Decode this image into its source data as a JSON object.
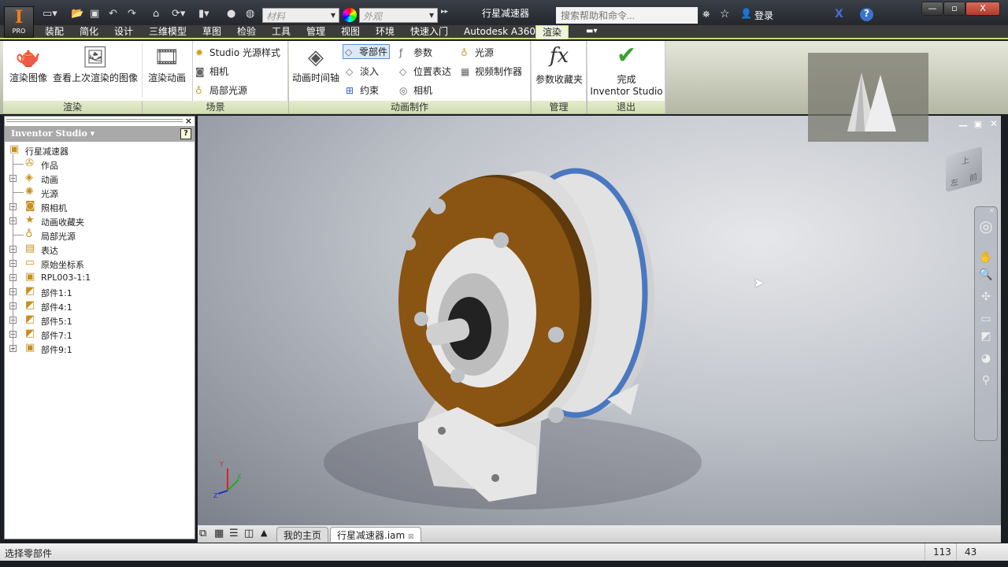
{
  "app": {
    "logo_letter": "I",
    "edition": "PRO",
    "document_title": "行星减速器"
  },
  "quick_access": {
    "material": "材料",
    "appearance": "外观",
    "icons": [
      "new-icon",
      "open-icon",
      "save-icon",
      "undo-icon",
      "redo-icon",
      "home-icon",
      "update-icon",
      "select-icon",
      "color-wheel-icon"
    ]
  },
  "search": {
    "placeholder": "搜索帮助和命令..."
  },
  "account": {
    "signin": "登录"
  },
  "tabs": [
    "装配",
    "简化",
    "设计",
    "三维模型",
    "草图",
    "检验",
    "工具",
    "管理",
    "视图",
    "环境",
    "快速入门",
    "Autodesk A360",
    "渲染"
  ],
  "active_tab": "渲染",
  "ribbon": {
    "render": {
      "label": "渲染",
      "render_image": "渲染图像",
      "view_last": "查看上次渲染的图像",
      "render_animation": "渲染动画"
    },
    "scene": {
      "label": "场景",
      "studio_lighting": "Studio 光源样式",
      "camera": "相机",
      "local_lights": "局部光源"
    },
    "animate": {
      "label": "动画制作",
      "timeline": "动画时间轴",
      "component": "零部件",
      "fade": "淡入",
      "constraints": "约束",
      "parameters": "参数",
      "positional_reps": "位置表达",
      "camera": "相机",
      "light": "光源",
      "video_producer": "视频制作器"
    },
    "manage": {
      "label": "管理",
      "param_favorites": "参数收藏夹"
    },
    "exit": {
      "label": "退出",
      "finish_line1": "完成",
      "finish_line2": "Inventor Studio"
    }
  },
  "browser": {
    "title": "Inventor Studio",
    "nodes": [
      {
        "label": "行星减速器",
        "expander": false,
        "level": 0,
        "icon": "assembly-icon"
      },
      {
        "label": "作品",
        "expander": false,
        "level": 1,
        "icon": "production-icon"
      },
      {
        "label": "动画",
        "expander": true,
        "level": 1,
        "icon": "animation-icon"
      },
      {
        "label": "光源",
        "expander": false,
        "level": 1,
        "icon": "light-icon"
      },
      {
        "label": "照相机",
        "expander": true,
        "level": 1,
        "icon": "camera-icon"
      },
      {
        "label": "动画收藏夹",
        "expander": true,
        "level": 1,
        "icon": "star-icon"
      },
      {
        "label": "局部光源",
        "expander": false,
        "level": 1,
        "icon": "bulb-icon"
      },
      {
        "label": "表达",
        "expander": true,
        "level": 1,
        "icon": "representation-icon"
      },
      {
        "label": "原始坐标系",
        "expander": true,
        "level": 1,
        "icon": "folder-icon"
      },
      {
        "label": "RPL003-1:1",
        "expander": true,
        "level": 1,
        "icon": "assembly-icon"
      },
      {
        "label": "部件1:1",
        "expander": true,
        "level": 1,
        "icon": "part-icon"
      },
      {
        "label": "部件4:1",
        "expander": true,
        "level": 1,
        "icon": "part-icon"
      },
      {
        "label": "部件5:1",
        "expander": true,
        "level": 1,
        "icon": "part-icon"
      },
      {
        "label": "部件7:1",
        "expander": true,
        "level": 1,
        "icon": "part-icon"
      },
      {
        "label": "部件9:1",
        "expander": true,
        "level": 1,
        "icon": "assembly-icon"
      }
    ]
  },
  "viewcube": {
    "top": "上",
    "left": "左",
    "front": "前"
  },
  "triad": {
    "x": "X",
    "y": "Y",
    "z": "Z"
  },
  "doc_tabs": {
    "home": "我的主页",
    "file": "行星减速器.iam"
  },
  "status": {
    "message": "选择零部件",
    "count1": "113",
    "count2": "43"
  },
  "colors": {
    "accent": "#c6d97a",
    "flange": "#7a4a10",
    "band": "#4a78c0"
  }
}
